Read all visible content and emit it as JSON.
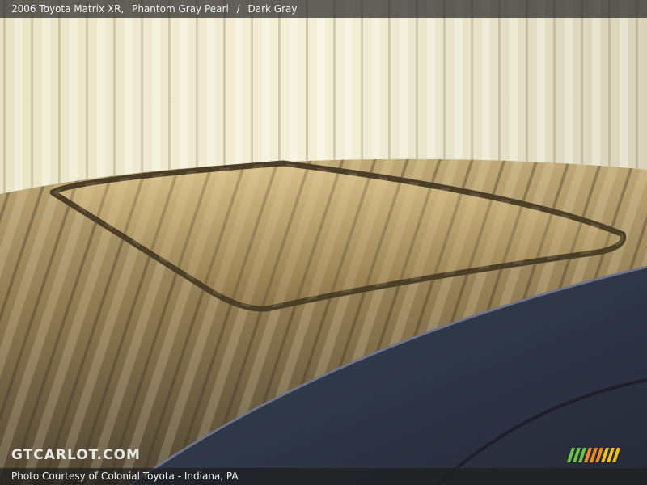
{
  "header": {
    "vehicle": "2006 Toyota Matrix XR,",
    "exterior": "Phantom Gray Pearl",
    "separator": "/",
    "interior": "Dark Gray"
  },
  "watermark": {
    "text": "GTCARLOT.COM"
  },
  "footer": {
    "credit": "Photo Courtesy of Colonial Toyota - Indiana, PA"
  },
  "colors": {
    "stripe_green": "#6cc24a",
    "stripe_orange": "#f08a24",
    "stripe_yellow": "#f3c21f"
  }
}
